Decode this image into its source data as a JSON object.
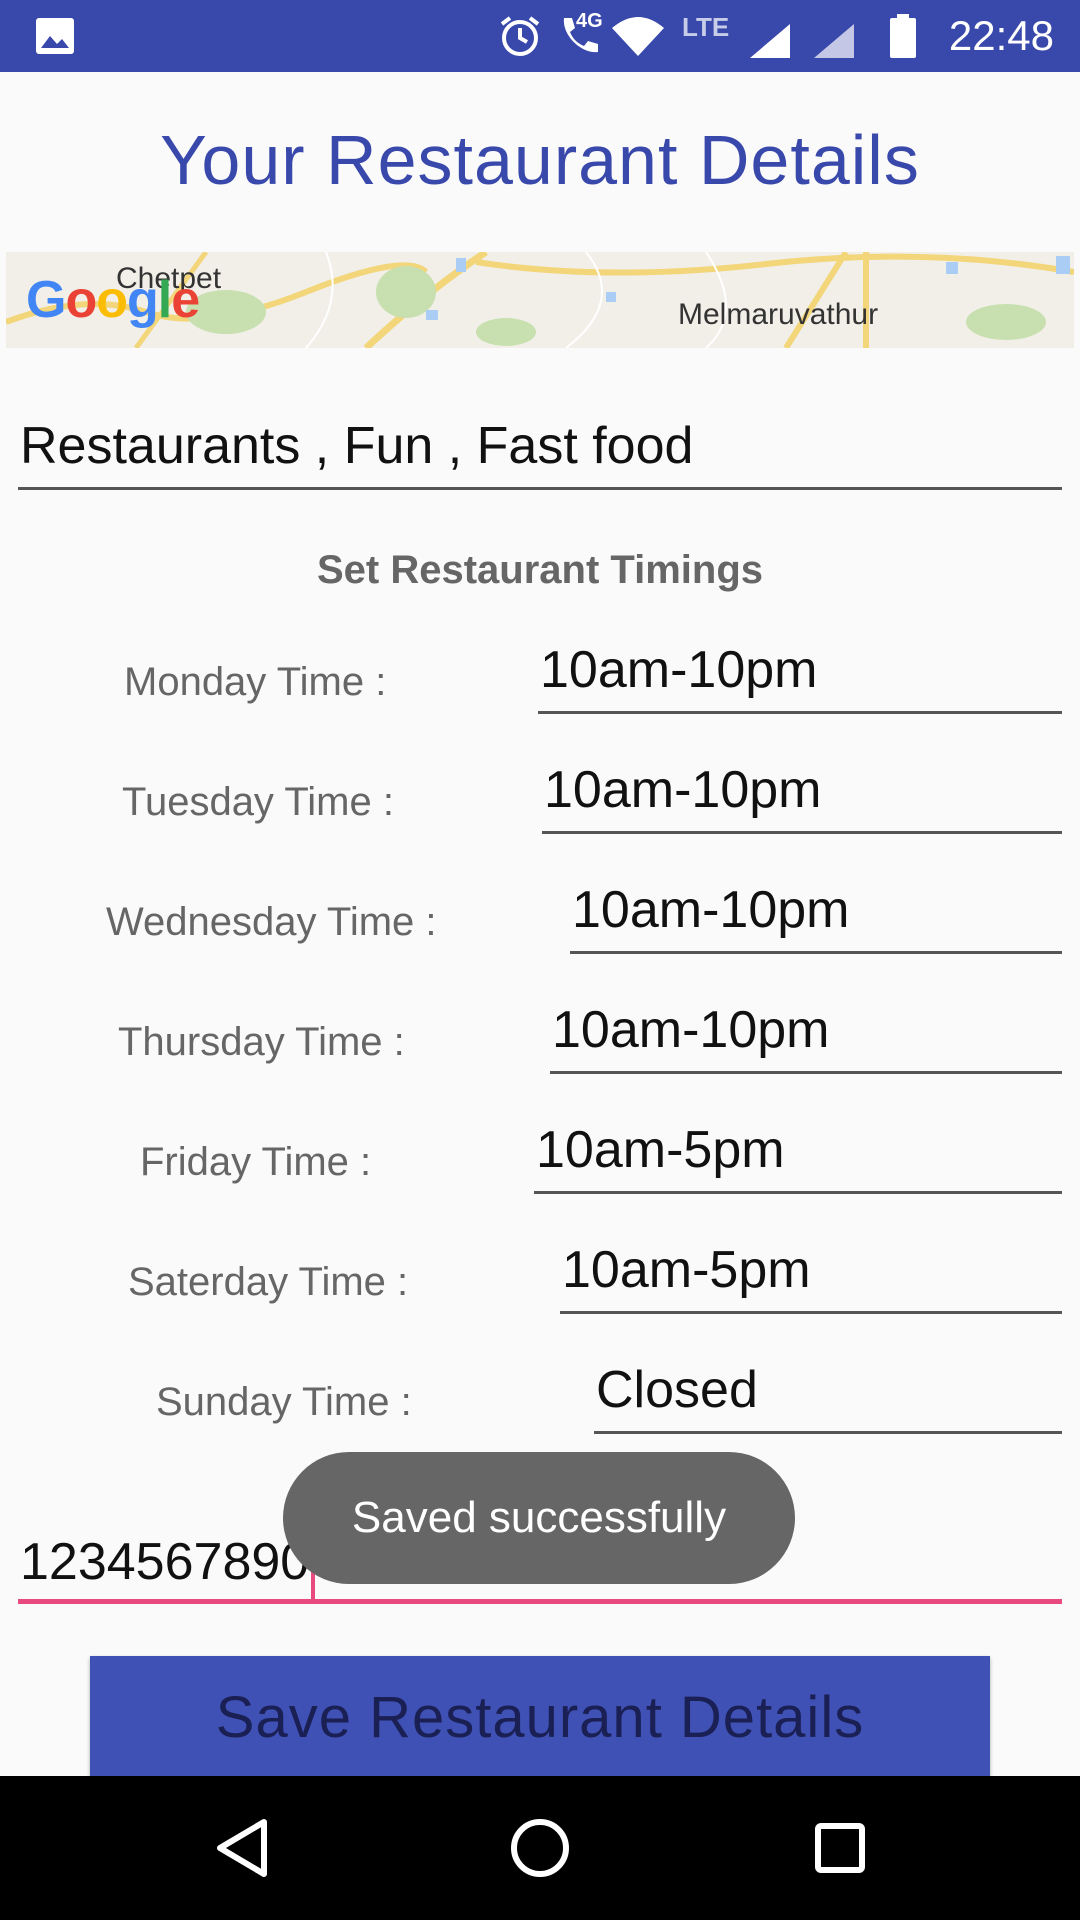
{
  "status_bar": {
    "time": "22:48",
    "network_label": "4G",
    "lte_label": "LTE",
    "icons": [
      "image-icon",
      "alarm-icon",
      "call-icon",
      "wifi-icon",
      "signal-icon",
      "signal-icon",
      "battery-icon"
    ]
  },
  "page": {
    "title": "Your Restaurant Details"
  },
  "map": {
    "label_left": "Chetpet",
    "label_right": "Melmaruvathur",
    "provider": "Google"
  },
  "categories": {
    "value": "Restaurants , Fun , Fast food"
  },
  "timings": {
    "heading": "Set Restaurant Timings",
    "days": [
      {
        "label": "Monday Time :",
        "value": "10am-10pm"
      },
      {
        "label": "Tuesday Time :",
        "value": "10am-10pm"
      },
      {
        "label": "Wednesday Time :",
        "value": "10am-10pm"
      },
      {
        "label": "Thursday Time :",
        "value": "10am-10pm"
      },
      {
        "label": "Friday Time :",
        "value": "10am-5pm"
      },
      {
        "label": "Saterday Time :",
        "value": "10am-5pm"
      },
      {
        "label": "Sunday Time :",
        "value": "Closed"
      }
    ]
  },
  "phone": {
    "value": "1234567890"
  },
  "save_button": {
    "label": "Save Restaurant Details"
  },
  "toast": {
    "message": "Saved successfully"
  },
  "nav_bar": {
    "icons": [
      "back-icon",
      "home-icon",
      "recents-icon"
    ]
  },
  "colors": {
    "primary": "#3948ab",
    "accent": "#e8497f",
    "button": "#3f51b5"
  }
}
